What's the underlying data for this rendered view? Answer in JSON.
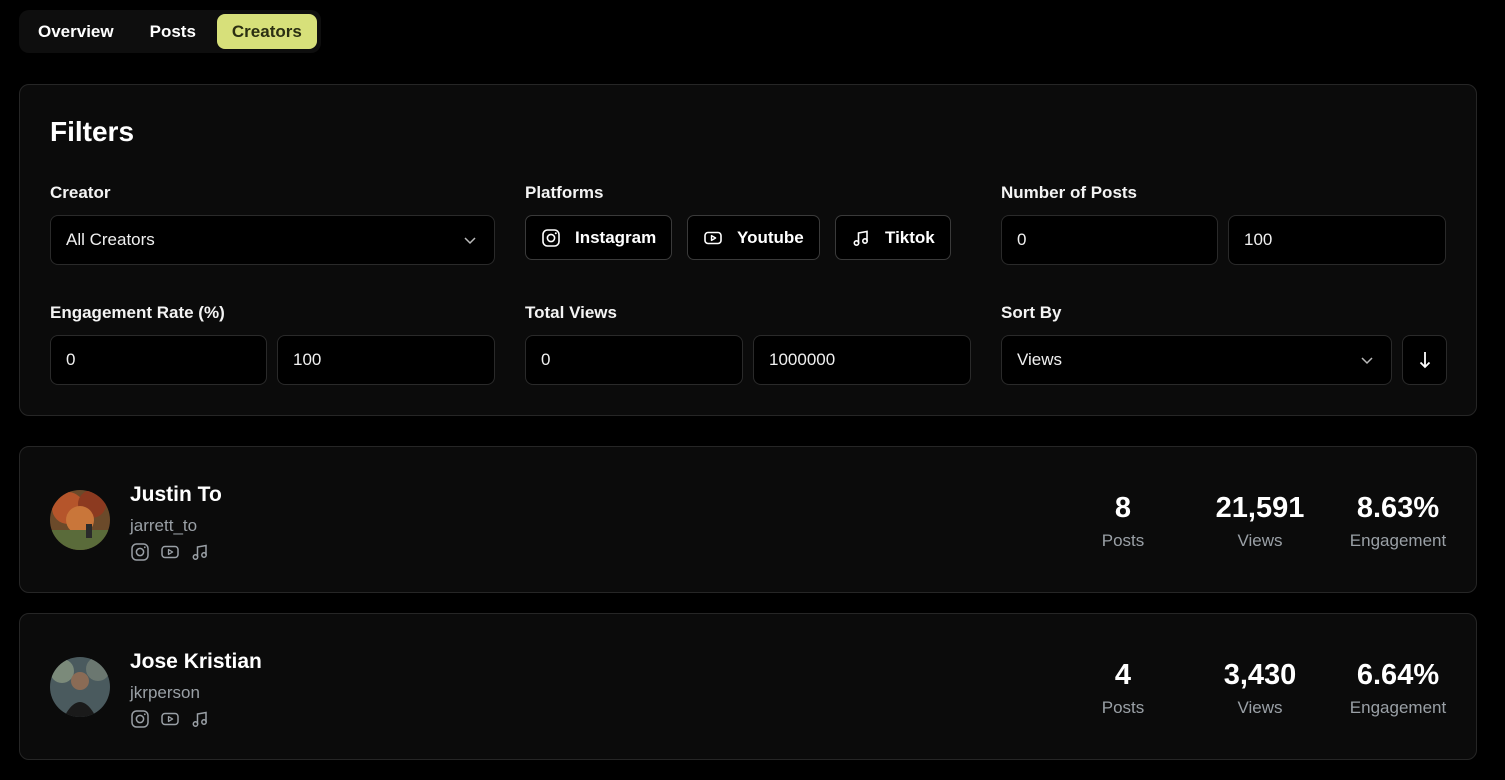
{
  "tabs": [
    {
      "label": "Overview",
      "active": false
    },
    {
      "label": "Posts",
      "active": false
    },
    {
      "label": "Creators",
      "active": true
    }
  ],
  "filters": {
    "title": "Filters",
    "creator": {
      "label": "Creator",
      "value": "All Creators"
    },
    "platforms": {
      "label": "Platforms",
      "options": [
        "Instagram",
        "Youtube",
        "Tiktok"
      ]
    },
    "posts": {
      "label": "Number of Posts",
      "min": "0",
      "max": "100"
    },
    "engagement": {
      "label": "Engagement Rate (%)",
      "min": "0",
      "max": "100"
    },
    "views": {
      "label": "Total Views",
      "min": "0",
      "max": "1000000"
    },
    "sort": {
      "label": "Sort By",
      "value": "Views",
      "direction_icon": "arrow-down-icon"
    }
  },
  "creators": [
    {
      "name": "Justin To",
      "handle": "jarrett_to",
      "platforms": [
        "instagram-icon",
        "youtube-icon",
        "tiktok-icon"
      ],
      "posts": "8",
      "posts_label": "Posts",
      "views": "21,591",
      "views_label": "Views",
      "engagement": "8.63%",
      "engagement_label": "Engagement"
    },
    {
      "name": "Jose Kristian",
      "handle": "jkrperson",
      "platforms": [
        "instagram-icon",
        "youtube-icon",
        "tiktok-icon"
      ],
      "posts": "4",
      "posts_label": "Posts",
      "views": "3,430",
      "views_label": "Views",
      "engagement": "6.64%",
      "engagement_label": "Engagement"
    }
  ],
  "colors": {
    "accent": "#d7e07a",
    "background": "#000000",
    "card": "#0b0b0b",
    "muted": "#9aa0a6"
  }
}
